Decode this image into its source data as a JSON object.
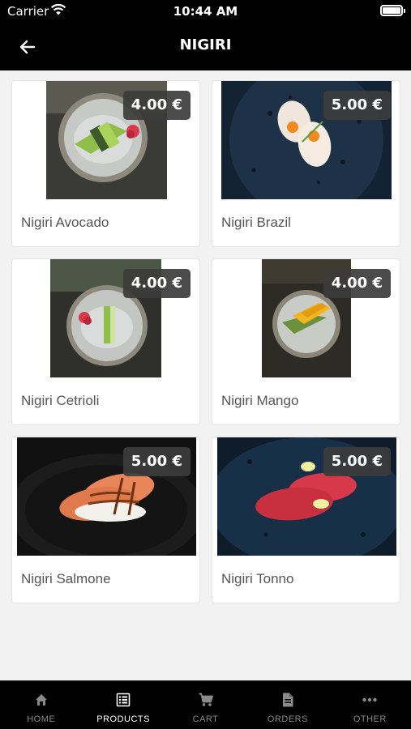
{
  "status_bar": {
    "carrier": "Carrier",
    "time": "10:44 AM"
  },
  "header": {
    "title": "NIGIRI"
  },
  "products": [
    {
      "name": "Nigiri Avocado",
      "price": "4.00 €"
    },
    {
      "name": "Nigiri Brazil",
      "price": "5.00 €"
    },
    {
      "name": "Nigiri Cetrioli",
      "price": "4.00 €"
    },
    {
      "name": "Nigiri Mango",
      "price": "4.00 €"
    },
    {
      "name": "Nigiri Salmone",
      "price": "5.00 €"
    },
    {
      "name": "Nigiri Tonno",
      "price": "5.00 €"
    }
  ],
  "bottom_nav": [
    {
      "label": "HOME",
      "icon": "home-icon"
    },
    {
      "label": "PRODUCTS",
      "icon": "list-icon",
      "active": true
    },
    {
      "label": "CART",
      "icon": "cart-icon"
    },
    {
      "label": "ORDERS",
      "icon": "document-icon"
    },
    {
      "label": "OTHER",
      "icon": "more-icon"
    }
  ]
}
